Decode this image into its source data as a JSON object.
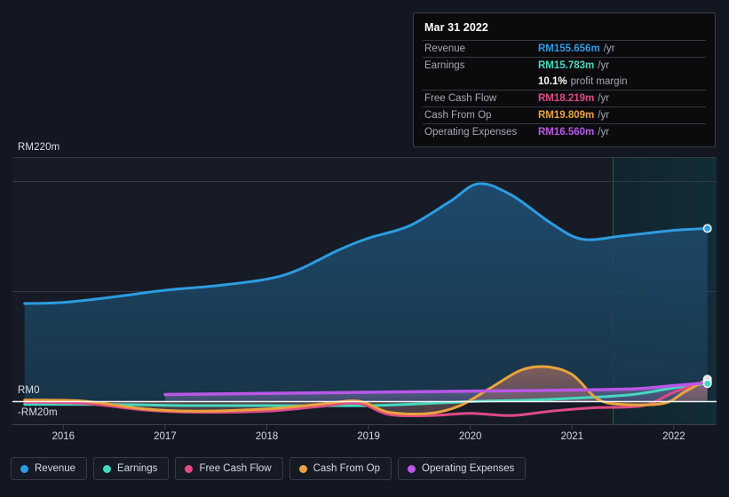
{
  "chart_data": {
    "type": "area",
    "title": "",
    "xlabel": "",
    "ylabel": "",
    "currency": "RM",
    "ylim": [
      -20,
      220
    ],
    "y_ticks": [
      {
        "label": "RM220m",
        "value": 220
      },
      {
        "label": "RM0",
        "value": 0
      },
      {
        "label": "-RM20m",
        "value": -20
      }
    ],
    "grid": true,
    "legend_position": "bottom",
    "x_ticks": [
      "2016",
      "2017",
      "2018",
      "2019",
      "2020",
      "2021",
      "2022"
    ],
    "x_range": [
      "2015.5",
      "2022.4"
    ],
    "forecast_start": "2021",
    "series": [
      {
        "name": "Revenue",
        "color": "#2D9CE0",
        "values": [
          {
            "x": 2015.62,
            "y": 88
          },
          {
            "x": 2016.0,
            "y": 89
          },
          {
            "x": 2016.5,
            "y": 94
          },
          {
            "x": 2017.0,
            "y": 100
          },
          {
            "x": 2017.5,
            "y": 104
          },
          {
            "x": 2018.0,
            "y": 110
          },
          {
            "x": 2018.3,
            "y": 118
          },
          {
            "x": 2018.7,
            "y": 136
          },
          {
            "x": 2019.0,
            "y": 147
          },
          {
            "x": 2019.4,
            "y": 158
          },
          {
            "x": 2019.8,
            "y": 180
          },
          {
            "x": 2020.08,
            "y": 196
          },
          {
            "x": 2020.4,
            "y": 186
          },
          {
            "x": 2020.8,
            "y": 160
          },
          {
            "x": 2021.1,
            "y": 146
          },
          {
            "x": 2021.5,
            "y": 149
          },
          {
            "x": 2022.0,
            "y": 154
          },
          {
            "x": 2022.33,
            "y": 155.656
          }
        ]
      },
      {
        "name": "Earnings",
        "color": "#45D8C0",
        "values": [
          {
            "x": 2015.62,
            "y": -3
          },
          {
            "x": 2016.5,
            "y": -3
          },
          {
            "x": 2017.2,
            "y": -4
          },
          {
            "x": 2018.0,
            "y": -4
          },
          {
            "x": 2019.0,
            "y": -4
          },
          {
            "x": 2019.6,
            "y": -2
          },
          {
            "x": 2020.1,
            "y": 0
          },
          {
            "x": 2020.6,
            "y": 1
          },
          {
            "x": 2021.1,
            "y": 3
          },
          {
            "x": 2021.6,
            "y": 6
          },
          {
            "x": 2022.0,
            "y": 12
          },
          {
            "x": 2022.33,
            "y": 15.783
          }
        ]
      },
      {
        "name": "Free Cash Flow",
        "color": "#E04A86",
        "values": [
          {
            "x": 2015.62,
            "y": -1
          },
          {
            "x": 2016.2,
            "y": -2
          },
          {
            "x": 2016.8,
            "y": -8
          },
          {
            "x": 2017.3,
            "y": -10
          },
          {
            "x": 2018.0,
            "y": -9
          },
          {
            "x": 2018.5,
            "y": -5
          },
          {
            "x": 2018.9,
            "y": -2
          },
          {
            "x": 2019.2,
            "y": -12
          },
          {
            "x": 2019.6,
            "y": -13
          },
          {
            "x": 2020.0,
            "y": -11
          },
          {
            "x": 2020.4,
            "y": -13
          },
          {
            "x": 2020.8,
            "y": -9
          },
          {
            "x": 2021.2,
            "y": -6
          },
          {
            "x": 2021.7,
            "y": -4
          },
          {
            "x": 2022.0,
            "y": 8
          },
          {
            "x": 2022.33,
            "y": 18.219
          }
        ]
      },
      {
        "name": "Cash From Op",
        "color": "#E9A33C",
        "values": [
          {
            "x": 2015.62,
            "y": 1
          },
          {
            "x": 2016.2,
            "y": 0
          },
          {
            "x": 2016.8,
            "y": -7
          },
          {
            "x": 2017.3,
            "y": -9
          },
          {
            "x": 2018.0,
            "y": -7
          },
          {
            "x": 2018.5,
            "y": -3
          },
          {
            "x": 2018.9,
            "y": 0
          },
          {
            "x": 2019.2,
            "y": -10
          },
          {
            "x": 2019.6,
            "y": -11
          },
          {
            "x": 2019.9,
            "y": -4
          },
          {
            "x": 2020.2,
            "y": 12
          },
          {
            "x": 2020.5,
            "y": 28
          },
          {
            "x": 2020.75,
            "y": 31
          },
          {
            "x": 2021.0,
            "y": 24
          },
          {
            "x": 2021.25,
            "y": 2
          },
          {
            "x": 2021.5,
            "y": -3
          },
          {
            "x": 2021.9,
            "y": -2
          },
          {
            "x": 2022.1,
            "y": 8
          },
          {
            "x": 2022.33,
            "y": 19.809
          }
        ]
      },
      {
        "name": "Operating Expenses",
        "color": "#B957E8",
        "values": [
          {
            "x": 2017.0,
            "y": 6
          },
          {
            "x": 2018.0,
            "y": 7
          },
          {
            "x": 2019.0,
            "y": 8
          },
          {
            "x": 2020.0,
            "y": 9
          },
          {
            "x": 2021.0,
            "y": 10
          },
          {
            "x": 2021.6,
            "y": 11
          },
          {
            "x": 2022.0,
            "y": 14
          },
          {
            "x": 2022.33,
            "y": 16.56
          }
        ]
      }
    ]
  },
  "tooltip": {
    "date": "Mar 31 2022",
    "rows": [
      {
        "label": "Revenue",
        "value": "RM155.656m",
        "unit": "/yr",
        "color": "#2D9CE0"
      },
      {
        "label": "Earnings",
        "value": "RM15.783m",
        "unit": "/yr",
        "color": "#45D8C0"
      },
      {
        "label": "Free Cash Flow",
        "value": "RM18.219m",
        "unit": "/yr",
        "color": "#E04A86"
      },
      {
        "label": "Cash From Op",
        "value": "RM19.809m",
        "unit": "/yr",
        "color": "#E9A33C"
      },
      {
        "label": "Operating Expenses",
        "value": "RM16.560m",
        "unit": "/yr",
        "color": "#B957E8"
      }
    ],
    "margin_value": "10.1%",
    "margin_label": "profit margin"
  },
  "legend": {
    "items": [
      {
        "label": "Revenue",
        "color": "#2D9CE0"
      },
      {
        "label": "Earnings",
        "color": "#45D8C0"
      },
      {
        "label": "Free Cash Flow",
        "color": "#E04A86"
      },
      {
        "label": "Cash From Op",
        "color": "#E9A33C"
      },
      {
        "label": "Operating Expenses",
        "color": "#B957E8"
      }
    ]
  },
  "axis": {
    "top_label": "RM220m",
    "zero_label": "RM0",
    "negative_label": "-RM20m"
  }
}
